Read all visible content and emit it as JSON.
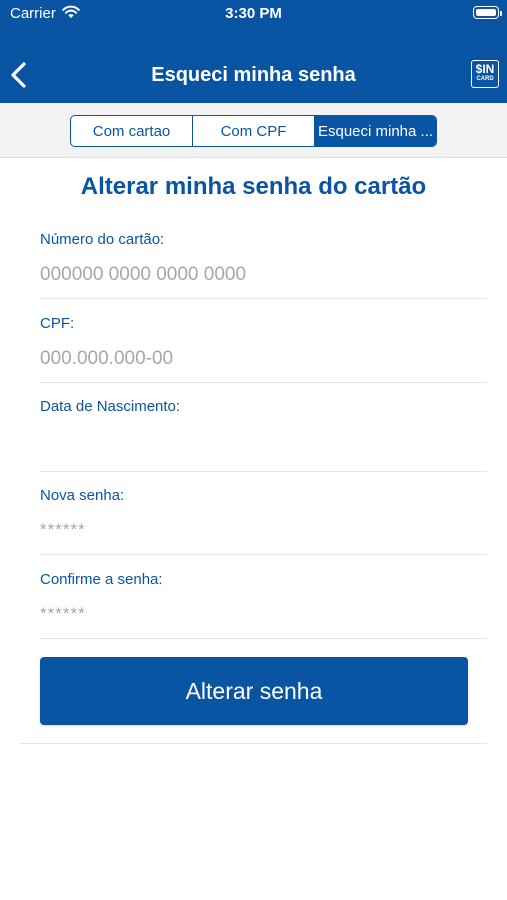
{
  "status_bar": {
    "carrier": "Carrier",
    "time": "3:30 PM"
  },
  "nav": {
    "title": "Esqueci minha senha",
    "back_icon": "chevron-left-icon",
    "logo_text_top": "$IN",
    "logo_text_bottom": "CARD"
  },
  "segments": [
    {
      "label": "Com cartao",
      "active": false
    },
    {
      "label": "Com CPF",
      "active": false
    },
    {
      "label": "Esqueci minha ...",
      "active": true
    }
  ],
  "form": {
    "heading": "Alterar minha senha do cartão",
    "fields": {
      "card_number": {
        "label": "Número do cartão:",
        "placeholder": "000000 0000 0000 0000"
      },
      "cpf": {
        "label": "CPF:",
        "placeholder": "000.000.000-00"
      },
      "birth_date": {
        "label": "Data de Nascimento:",
        "placeholder": ""
      },
      "new_password": {
        "label": "Nova senha:",
        "placeholder": "******"
      },
      "confirm_password": {
        "label": "Confirme a senha:",
        "placeholder": "******"
      }
    },
    "submit_label": "Alterar senha"
  },
  "colors": {
    "brand_blue": "#0a55a3",
    "placeholder_gray": "#a7a7a7",
    "segment_bar_bg": "#f3f3f3"
  }
}
